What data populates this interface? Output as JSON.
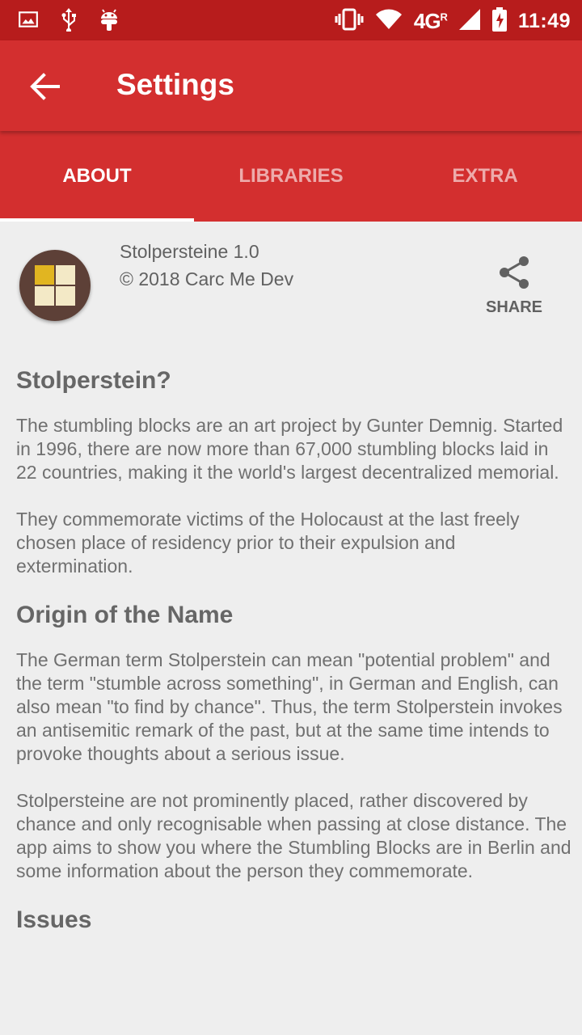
{
  "status_bar": {
    "network": "4G",
    "network_sup": "R",
    "time": "11:49"
  },
  "app_bar": {
    "title": "Settings"
  },
  "tabs": [
    {
      "label": "ABOUT"
    },
    {
      "label": "LIBRARIES"
    },
    {
      "label": "EXTRA"
    }
  ],
  "about": {
    "app_name": "Stolpersteine 1.0",
    "copyright": "© 2018 Carc Me Dev",
    "share_label": "SHARE"
  },
  "sections": [
    {
      "heading": "Stolperstein?",
      "paragraphs": [
        "The stumbling blocks are an art project by Gunter Demnig. Started in 1996, there are now more than 67,000 stumbling blocks laid in 22 countries, making it the world's largest decentralized memorial.",
        "They commemorate victims of the Holocaust at the last freely chosen place of residency prior to their expulsion and extermination."
      ]
    },
    {
      "heading": "Origin of the Name",
      "paragraphs": [
        "The German term Stolperstein can mean \"potential problem\" and the term \"stumble across something\", in German and English, can also mean \"to find by chance\". Thus, the term Stolperstein invokes an antisemitic remark of the past, but at the same time intends to provoke thoughts about a serious issue.",
        "Stolpersteine are not prominently placed, rather discovered by chance and only recognisable when passing at close distance. The app aims to show you where the Stumbling Blocks are in Berlin and some information about the person they commemorate."
      ]
    },
    {
      "heading": "Issues",
      "paragraphs": []
    }
  ],
  "colors": {
    "status_bar": "#b71c1c",
    "primary": "#d32f2f",
    "background": "#eeeeee",
    "logo_bg": "#5d4037",
    "logo_gold": "#e1b521",
    "logo_cream": "#f3e9c6"
  },
  "icons": [
    "image-icon",
    "usb-icon",
    "android-icon",
    "vibrate-icon",
    "wifi-icon",
    "signal-icon",
    "battery-charging-icon",
    "back-arrow-icon",
    "share-icon"
  ]
}
